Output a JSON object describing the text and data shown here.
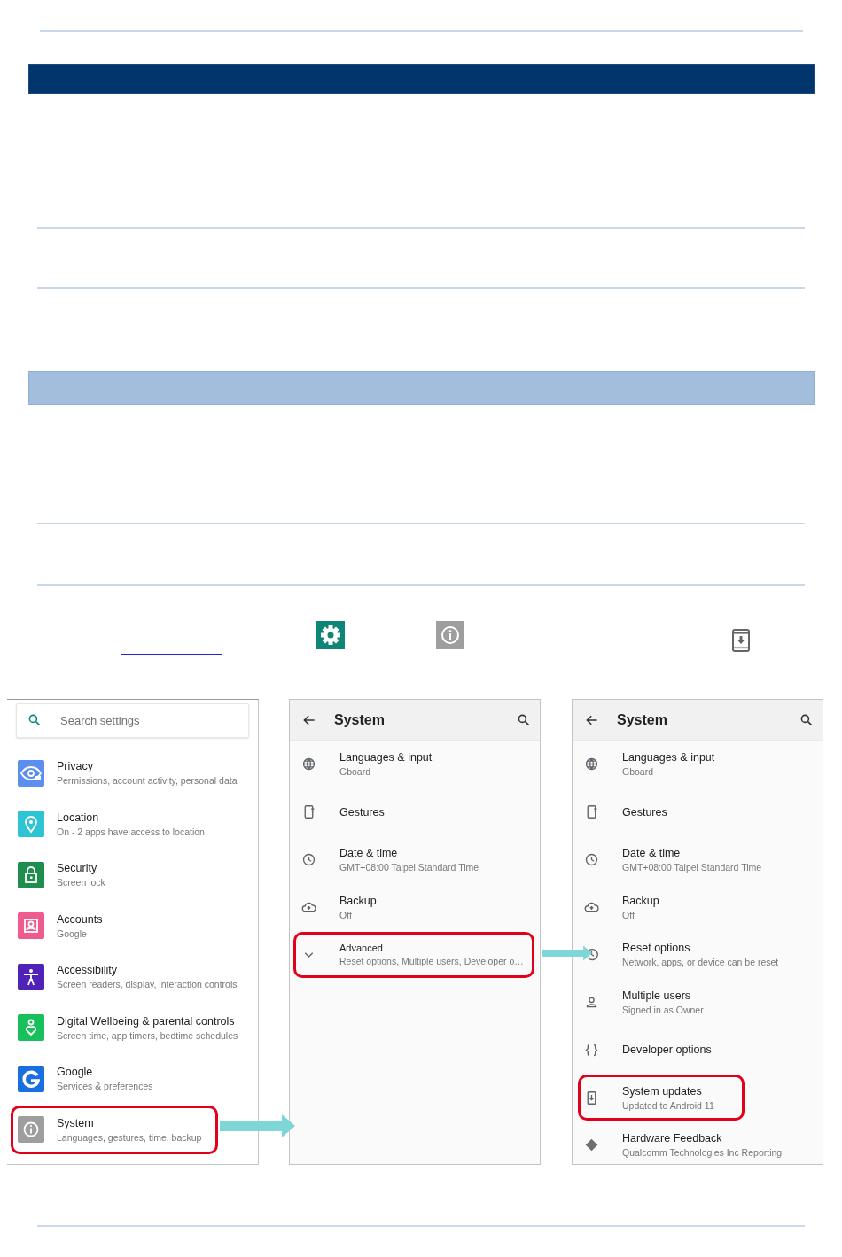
{
  "screens": [
    {
      "kind": "home",
      "search": {
        "placeholder": "Search settings"
      },
      "items": [
        {
          "title": "Privacy",
          "summary": "Permissions, account activity, personal data",
          "color": "#5c8ef0",
          "highlighted": false
        },
        {
          "title": "Location",
          "summary": "On - 2 apps have access to location",
          "color": "#2ec4d6",
          "highlighted": false
        },
        {
          "title": "Security",
          "summary": "Screen lock",
          "color": "#1e8e4e",
          "highlighted": false
        },
        {
          "title": "Accounts",
          "summary": "Google",
          "color": "#ef5b8f",
          "highlighted": false
        },
        {
          "title": "Accessibility",
          "summary": "Screen readers, display, interaction controls",
          "color": "#4f22b8",
          "highlighted": false
        },
        {
          "title": "Digital Wellbeing & parental controls",
          "summary": "Screen time, app timers, bedtime schedules",
          "color": "#17c05a",
          "highlighted": false
        },
        {
          "title": "Google",
          "summary": "Services & preferences",
          "color": "#1a6fe0",
          "highlighted": false
        },
        {
          "title": "System",
          "summary": "Languages, gestures, time, backup",
          "color": "#9e9e9e",
          "highlighted": true
        }
      ]
    },
    {
      "kind": "system",
      "title": "System",
      "items": [
        {
          "kind": "setting",
          "title": "Languages & input",
          "summary": "Gboard",
          "highlighted": false
        },
        {
          "kind": "setting",
          "title": "Gestures",
          "highlighted": false
        },
        {
          "kind": "setting",
          "title": "Date & time",
          "summary": "GMT+08:00 Taipei Standard Time",
          "highlighted": false
        },
        {
          "kind": "setting",
          "title": "Backup",
          "summary": "Off",
          "highlighted": false
        },
        {
          "kind": "expander",
          "title": "Advanced",
          "summary": "Reset options, Multiple users, Developer o…",
          "highlighted": true
        }
      ]
    },
    {
      "kind": "system",
      "title": "System",
      "items": [
        {
          "kind": "setting",
          "title": "Languages & input",
          "summary": "Gboard",
          "highlighted": false
        },
        {
          "kind": "setting",
          "title": "Gestures",
          "highlighted": false
        },
        {
          "kind": "setting",
          "title": "Date & time",
          "summary": "GMT+08:00 Taipei Standard Time",
          "highlighted": false
        },
        {
          "kind": "setting",
          "title": "Backup",
          "summary": "Off",
          "highlighted": false
        },
        {
          "kind": "setting",
          "title": "Reset options",
          "summary": "Network, apps, or device can be reset",
          "highlighted": false
        },
        {
          "kind": "setting",
          "title": "Multiple users",
          "summary": "Signed in as Owner",
          "highlighted": false
        },
        {
          "kind": "setting",
          "title": "Developer options",
          "highlighted": false
        },
        {
          "kind": "setting",
          "title": "System updates",
          "summary": "Updated to Android 11",
          "highlighted": true
        },
        {
          "kind": "setting",
          "title": "Hardware Feedback",
          "summary": "Qualcomm Technologies Inc Reporting",
          "highlighted": false
        }
      ]
    }
  ]
}
